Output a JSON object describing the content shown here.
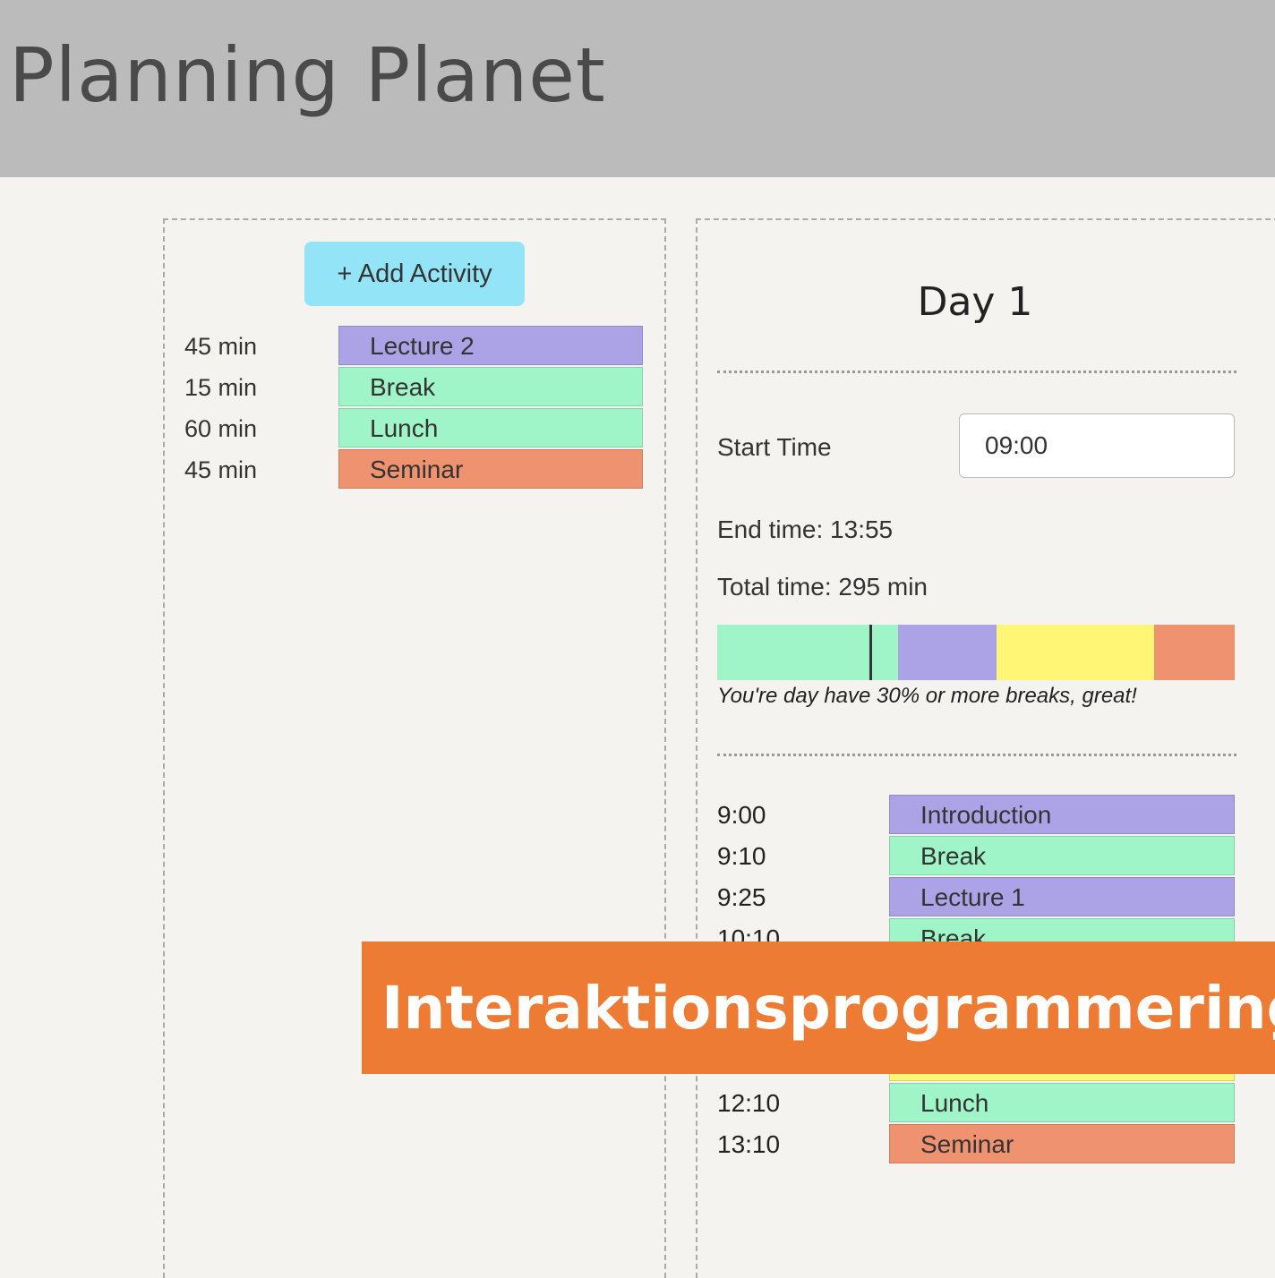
{
  "app": {
    "title": "Planning Planet"
  },
  "activities": {
    "add_label": "+ Add Activity",
    "items": [
      {
        "duration": "45 min",
        "name": "Lecture 2",
        "color": "#aba3e6"
      },
      {
        "duration": "15 min",
        "name": "Break",
        "color": "#9ff5c8"
      },
      {
        "duration": "60 min",
        "name": "Lunch",
        "color": "#9ff5c8"
      },
      {
        "duration": "45 min",
        "name": "Seminar",
        "color": "#ef9270"
      }
    ]
  },
  "day": {
    "title": "Day 1",
    "start_label": "Start Time",
    "start_value": "09:00",
    "end_text": "End time: 13:55",
    "total_text": "Total time: 295 min",
    "distribution": [
      {
        "color": "#9ff5c8",
        "fraction": 0.35
      },
      {
        "color": "#aba3e6",
        "fraction": 0.19
      },
      {
        "color": "#fff675",
        "fraction": 0.305
      },
      {
        "color": "#ef9270",
        "fraction": 0.155
      }
    ],
    "message": "You're day have 30% or more breaks, great!",
    "schedule": [
      {
        "time": "9:00",
        "name": "Introduction",
        "color": "#aba3e6"
      },
      {
        "time": "9:10",
        "name": "Break",
        "color": "#9ff5c8"
      },
      {
        "time": "9:25",
        "name": "Lecture 1",
        "color": "#aba3e6"
      },
      {
        "time": "10:10",
        "name": "Break",
        "color": "#9ff5c8"
      },
      {
        "time": "",
        "name": "",
        "color": "#fff675"
      },
      {
        "time": "",
        "name": "",
        "color": "#fff675"
      },
      {
        "time": "",
        "name": "",
        "color": "#fff675"
      },
      {
        "time": "12:10",
        "name": "Lunch",
        "color": "#9ff5c8"
      },
      {
        "time": "13:10",
        "name": "Seminar",
        "color": "#ef9270"
      }
    ]
  },
  "banner": {
    "text": "Interaktionsprogrammering",
    "color": "#ed7b33"
  }
}
